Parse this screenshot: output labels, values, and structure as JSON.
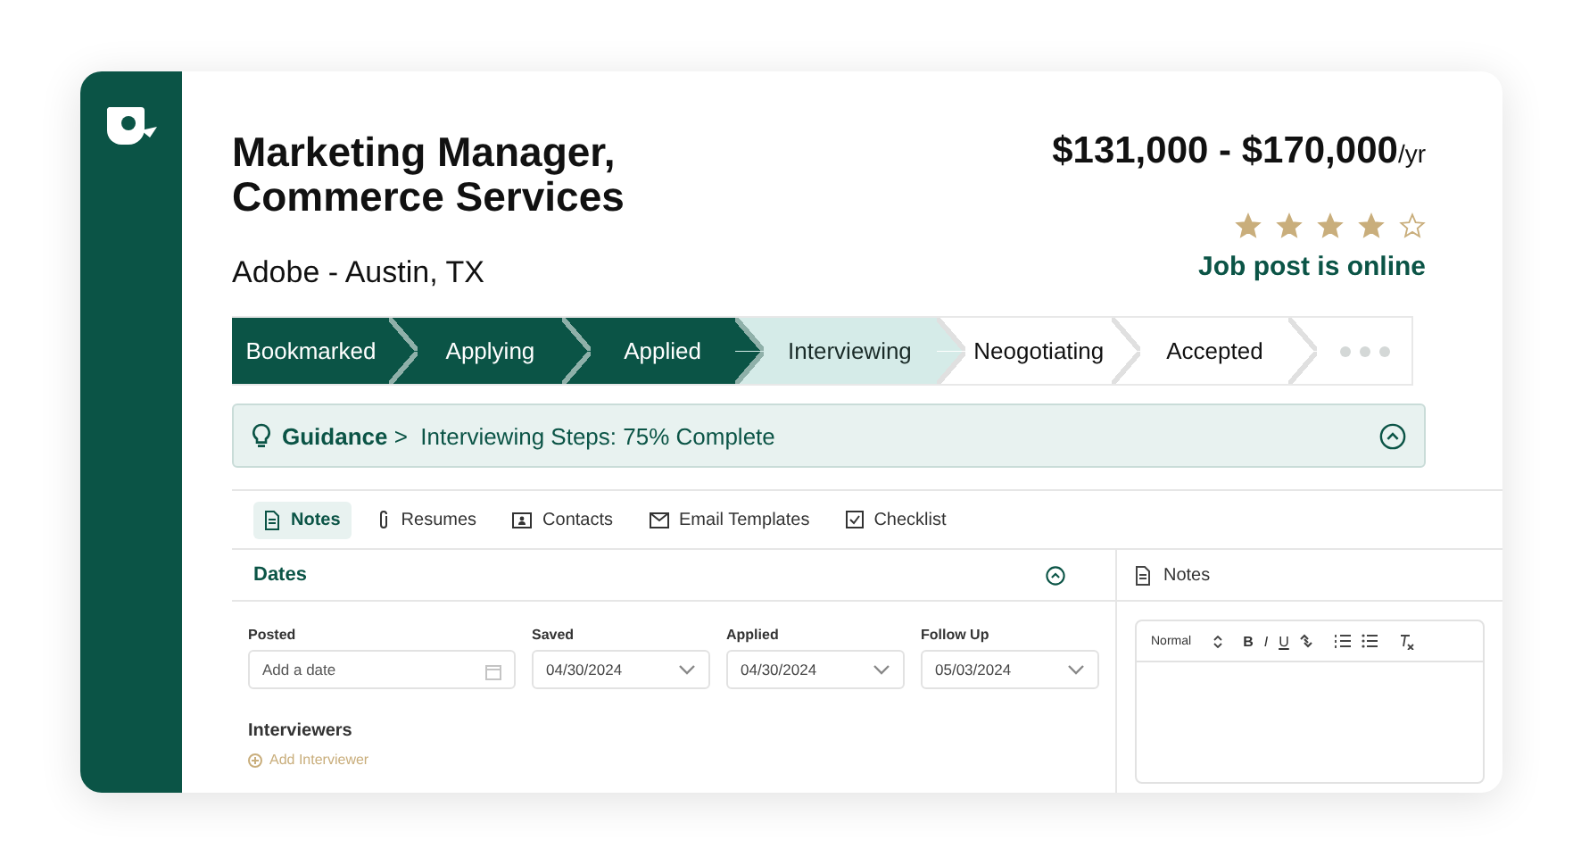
{
  "job": {
    "title": "Marketing Manager, Commerce Services",
    "company": "Adobe - Austin, TX",
    "salary": "$131,000 - $170,000",
    "salary_unit": "/yr",
    "stars": 4,
    "status": "Job post is online"
  },
  "stages": [
    {
      "label": "Bookmarked",
      "completed": true,
      "selected": false
    },
    {
      "label": "Applying",
      "completed": true,
      "selected": false
    },
    {
      "label": "Applied",
      "completed": true,
      "selected": false
    },
    {
      "label": "Interviewing",
      "completed": false,
      "selected": true
    },
    {
      "label": "Neogotiating",
      "completed": false,
      "selected": false
    },
    {
      "label": "Accepted",
      "completed": false,
      "selected": false
    }
  ],
  "guidance": {
    "text": "**Guidance** >  Interviewing Steps: 75% Complete",
    "expanded": true
  },
  "tabs": [
    {
      "label": "Notes",
      "selected": true
    },
    {
      "label": "Resumes",
      "selected": false
    },
    {
      "label": "Contacts",
      "selected": false
    },
    {
      "label": "Email Templates",
      "selected": false
    },
    {
      "label": "Checklist",
      "selected": false
    }
  ],
  "dates": {
    "title": "Dates",
    "expanded": true,
    "fields": [
      {
        "label": "Posted",
        "kind": "date",
        "placeholder": "Add a date"
      },
      {
        "label": "Saved",
        "kind": "select",
        "value": "04/30/2024"
      },
      {
        "label": "Applied",
        "kind": "select",
        "value": "04/30/2024"
      },
      {
        "label": "Follow Up",
        "kind": "select",
        "value": "05/03/2024"
      }
    ]
  },
  "interviewers": {
    "title": "Interviewers",
    "add_link": "Add Interviewer"
  },
  "notes": {
    "title": "Notes",
    "format": "Normal",
    "format_buttons": [
      "B",
      "I",
      "U"
    ]
  }
}
